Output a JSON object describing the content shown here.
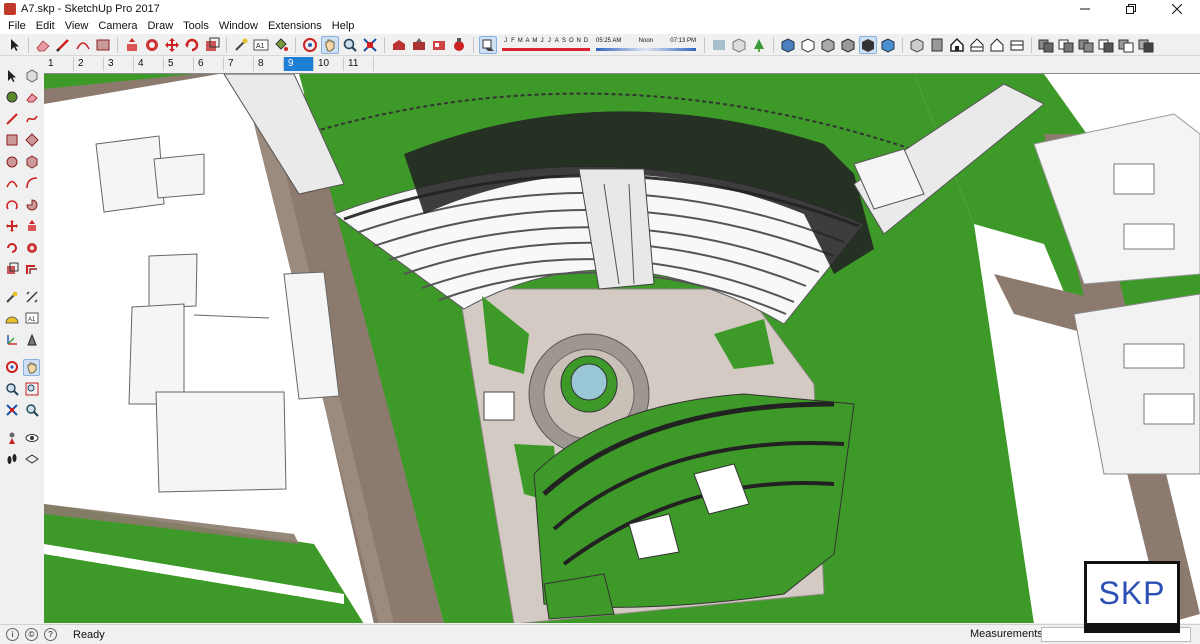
{
  "window": {
    "title": "A7.skp - SketchUp Pro 2017",
    "controls": [
      "minimize",
      "restore",
      "close"
    ]
  },
  "menu": [
    "File",
    "Edit",
    "View",
    "Camera",
    "Draw",
    "Tools",
    "Window",
    "Extensions",
    "Help"
  ],
  "shadow_settings": {
    "months": [
      "J",
      "F",
      "M",
      "A",
      "M",
      "J",
      "J",
      "A",
      "S",
      "O",
      "N",
      "D"
    ],
    "time_start": "05:25 AM",
    "time_mid": "Noon",
    "time_end": "07:13 PM"
  },
  "scene_tabs": [
    "1",
    "2",
    "3",
    "4",
    "5",
    "6",
    "7",
    "8",
    "9",
    "10",
    "11"
  ],
  "active_scene_tab": "9",
  "status": {
    "text": "Ready",
    "measurements_label": "Measurements",
    "measurements_value": ""
  },
  "watermark": "SKP",
  "colors": {
    "grass": "#3e9a28",
    "road": "#8b7a6d",
    "building_white": "#f2f2f2",
    "dark_roof": "#222222",
    "plaza": "#d3cbc3",
    "active_tab": "#1e7fd6",
    "watermark_text": "#2b4fb3"
  },
  "toolbar_icons": [
    "select-icon",
    "eraser-icon",
    "line-icon",
    "arc-icon",
    "shape-icon",
    "push-pull-icon",
    "move-icon",
    "rotate-icon",
    "scale-icon",
    "offset-icon",
    "tape-measure-icon",
    "text-icon",
    "paint-bucket-icon",
    "orbit-icon",
    "pan-icon",
    "zoom-icon",
    "zoom-extents-icon"
  ]
}
